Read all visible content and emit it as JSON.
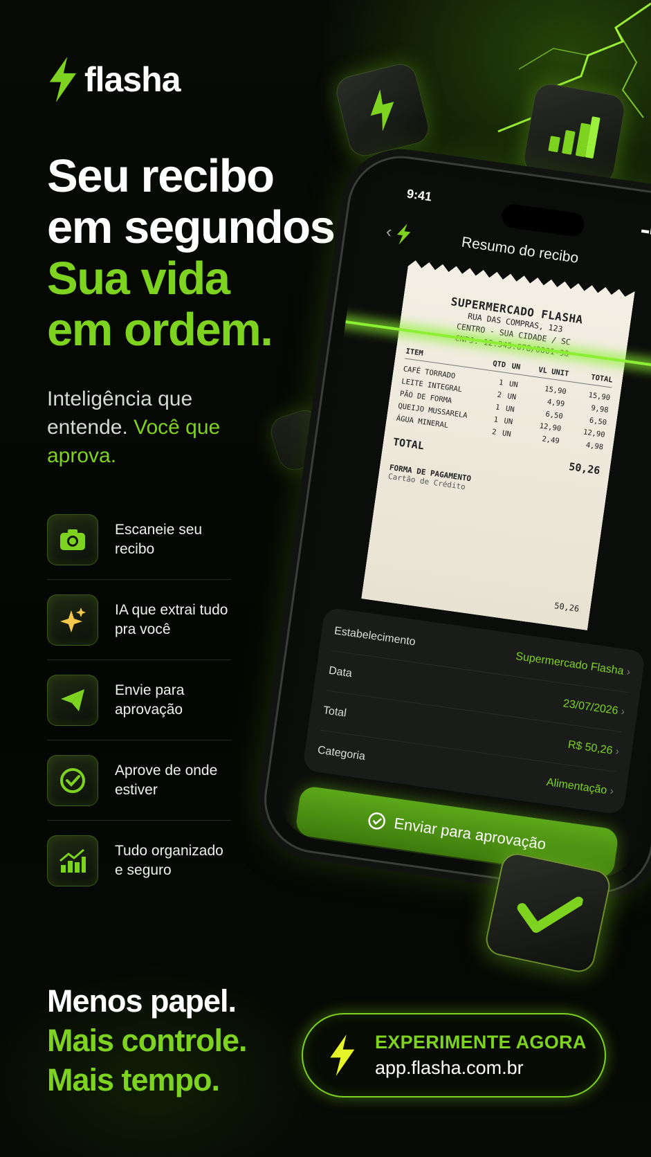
{
  "brand": {
    "name": "flasha",
    "accent": "#7ed321"
  },
  "headline": {
    "line1": "Seu recibo",
    "line2": "em segundos.",
    "line3": "Sua vida",
    "line4": "em ordem."
  },
  "subtitle": {
    "part1": "Inteligência que entende.",
    "part2": "Você que aprova."
  },
  "features": [
    {
      "icon": "camera-icon",
      "text1": "Escaneie seu recibo",
      "text2": ""
    },
    {
      "icon": "sparkles-icon",
      "text1": "IA que extrai tudo pra você",
      "text2": ""
    },
    {
      "icon": "paper-plane-icon",
      "text1": "Envie para aprovação",
      "text2": ""
    },
    {
      "icon": "check-circle-icon",
      "text1": "Aprove",
      "text2": " de onde estiver"
    },
    {
      "icon": "chart-growth-icon",
      "text1": "Tudo organizado e seguro",
      "text2": ""
    }
  ],
  "phone": {
    "time": "9:41",
    "title": "Resumo do recibo",
    "receipt": {
      "store": "SUPERMERCADO FLASHA",
      "address1": "RUA DAS COMPRAS, 123",
      "address2": "CENTRO - SUA CIDADE / SC",
      "cnpj": "CNPJ: 12.345.678/0001-90",
      "headers": {
        "item": "ITEM",
        "qtd": "QTD",
        "un": "UN",
        "vl": "VL UNIT",
        "total": "TOTAL"
      },
      "rows": [
        {
          "item": "CAFÉ TORRADO",
          "qtd": "1",
          "un": "UN",
          "vl": "15,90",
          "total": "15,90"
        },
        {
          "item": "LEITE INTEGRAL",
          "qtd": "2",
          "un": "UN",
          "vl": "4,99",
          "total": "9,98"
        },
        {
          "item": "PÃO DE FORMA",
          "qtd": "1",
          "un": "UN",
          "vl": "6,50",
          "total": "6,50"
        },
        {
          "item": "QUEIJO MUSSARELA",
          "qtd": "1",
          "un": "UN",
          "vl": "12,90",
          "total": "12,90"
        },
        {
          "item": "ÁGUA MINERAL",
          "qtd": "2",
          "un": "UN",
          "vl": "2,49",
          "total": "4,98"
        }
      ],
      "total_label": "TOTAL",
      "total_value": "50,26",
      "payment_label": "FORMA DE PAGAMENTO",
      "payment_method": "Cartão de Crédito",
      "payment_amount": "50,26"
    },
    "details": [
      {
        "label": "Estabelecimento",
        "value": "Supermercado Flasha"
      },
      {
        "label": "Data",
        "value": "23/07/2026"
      },
      {
        "label": "Total",
        "value": "R$ 50,26"
      },
      {
        "label": "Categoria",
        "value": "Alimentação"
      }
    ],
    "cta": "Enviar para aprovação"
  },
  "bottom": {
    "line1": "Menos papel.",
    "line2": "Mais controle.",
    "line3": "Mais tempo."
  },
  "pill": {
    "cta": "EXPERIMENTE AGORA",
    "url": "app.flasha.com.br"
  }
}
